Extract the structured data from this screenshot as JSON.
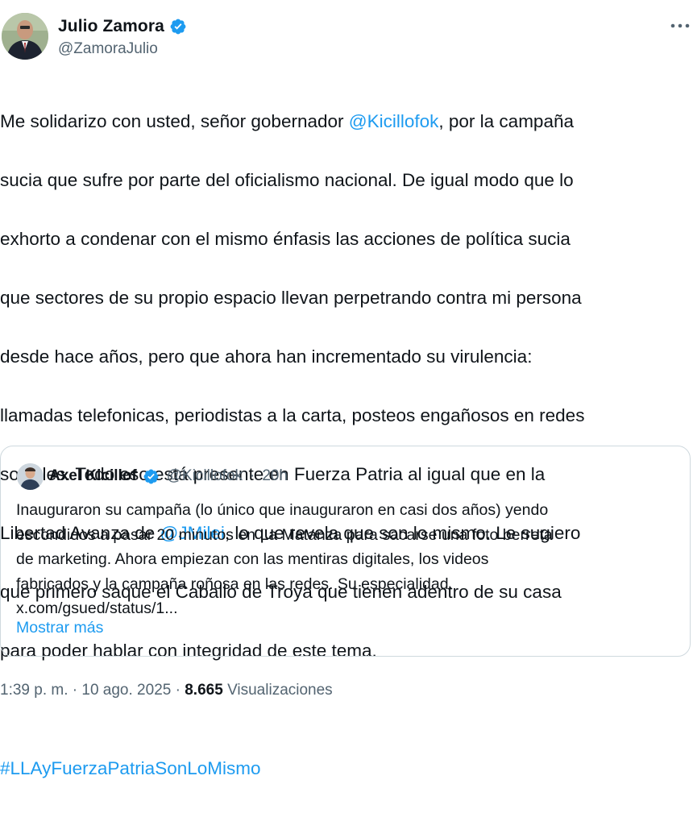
{
  "author": {
    "display_name": "Julio Zamora",
    "handle": "@ZamoraJulio"
  },
  "tweet": {
    "lines": [
      [
        "Me solidarizo con usted, señor gobernador ",
        "@Kicillofok",
        ", por la campaña"
      ],
      [
        "sucia que sufre por parte del oficialismo nacional. De igual modo que lo"
      ],
      [
        "exhorto a condenar con el mismo énfasis las acciones de política sucia"
      ],
      [
        "que sectores de su propio espacio llevan perpetrando contra mi persona"
      ],
      [
        "desde hace años, pero que ahora han incrementado su virulencia:"
      ],
      [
        "llamadas telefonicas, periodistas a la carta, posteos engañosos en redes"
      ],
      [
        "sociales. Todo eso está presente en Fuerza Patria al igual que en la"
      ],
      [
        "Libertad Avanza de ",
        "@JMilei",
        ", lo que revela que son lo mismo. Le sugiero"
      ],
      [
        "que primero saque el Caballo de Troya que tienen adentro de su casa"
      ],
      [
        "para poder hablar con integridad de este tema."
      ]
    ],
    "hashtag": "#LLAyFuerzaPatriaSonLoMismo"
  },
  "quoted": {
    "display_name": "Axel Kicillof",
    "handle": "@Kicillofok",
    "separator": "·",
    "time": "20h",
    "lines": [
      "Inauguraron su campaña (lo único que inauguraron en casi dos años) yendo",
      "escondidos a pasar 20 minutos en La Matanza para sacarse una foto berreta",
      "de marketing. Ahora empiezan con las mentiras digitales, los videos",
      "fabricados y la campaña roñosa en las redes. Su especialidad.",
      "x.com/gsued/status/1..."
    ],
    "show_more": "Mostrar más"
  },
  "footer": {
    "time": "1:39 p. m.",
    "date": "10 ago. 2025",
    "separator": "·",
    "views_count": "8.665",
    "views_label": "Visualizaciones"
  },
  "icons": {
    "verified": "verified-badge-icon",
    "more": "more-options-icon"
  },
  "colors": {
    "link": "#1d9bf0",
    "text": "#0f1419",
    "muted": "#536471",
    "border": "#cfd9de"
  }
}
